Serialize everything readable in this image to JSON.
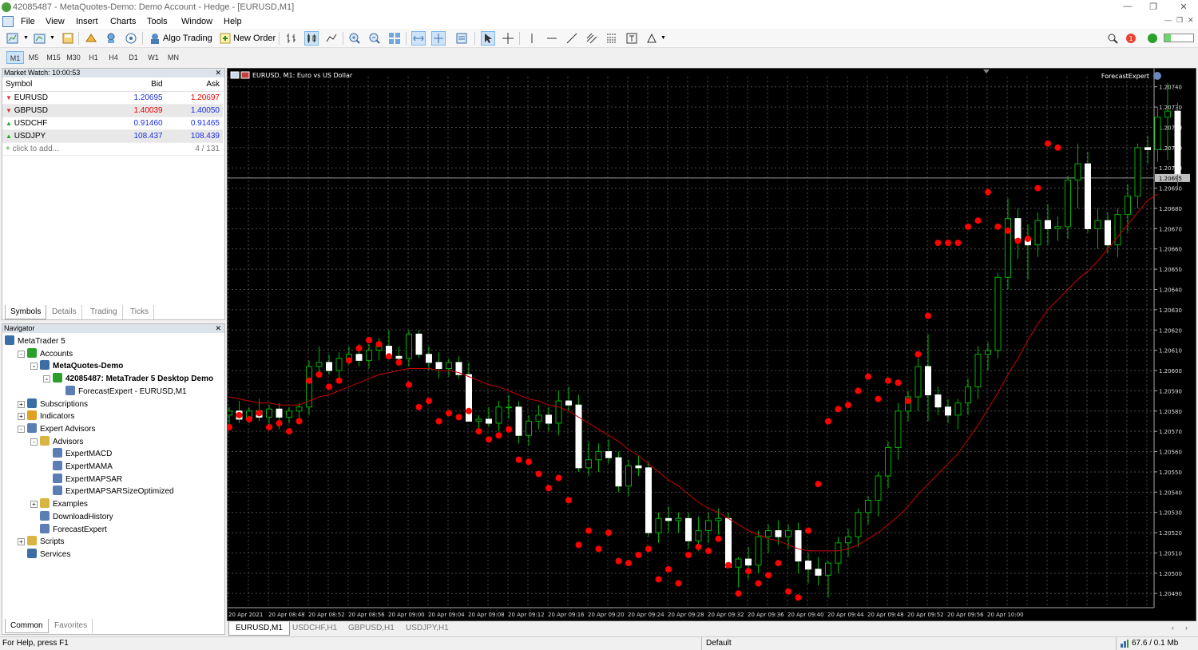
{
  "window": {
    "title": "42085487 - MetaQuotes-Demo: Demo Account - Hedge - [EURUSD,M1]"
  },
  "menu": [
    "File",
    "View",
    "Insert",
    "Charts",
    "Tools",
    "Window",
    "Help"
  ],
  "toolbar": {
    "algo_trading": "Algo Trading",
    "new_order": "New Order"
  },
  "timeframes": [
    "M1",
    "M5",
    "M15",
    "M30",
    "H1",
    "H4",
    "D1",
    "W1",
    "MN"
  ],
  "active_timeframe": "M1",
  "market_watch": {
    "title": "Market Watch: 10:00:53",
    "headers": [
      "Symbol",
      "Bid",
      "Ask"
    ],
    "rows": [
      {
        "symbol": "EURUSD",
        "bid": "1.20695",
        "ask": "1.20697",
        "dir": "down",
        "bid_color": "up",
        "ask_color": "dn"
      },
      {
        "symbol": "GBPUSD",
        "bid": "1.40039",
        "ask": "1.40050",
        "dir": "down",
        "bid_color": "dn",
        "ask_color": "up"
      },
      {
        "symbol": "USDCHF",
        "bid": "0.91460",
        "ask": "0.91465",
        "dir": "up",
        "bid_color": "up",
        "ask_color": "up"
      },
      {
        "symbol": "USDJPY",
        "bid": "108.437",
        "ask": "108.439",
        "dir": "up",
        "bid_color": "up",
        "ask_color": "up"
      }
    ],
    "add_text": "click to add...",
    "count": "4 / 131",
    "tabs": [
      "Symbols",
      "Details",
      "Trading",
      "Ticks"
    ]
  },
  "navigator": {
    "title": "Navigator",
    "items": [
      {
        "label": "MetaTrader 5",
        "level": 0,
        "icon": "mt5-icon",
        "expand": ""
      },
      {
        "label": "Accounts",
        "level": 1,
        "icon": "accounts-icon",
        "expand": "-"
      },
      {
        "label": "MetaQuotes-Demo",
        "level": 2,
        "icon": "server-icon",
        "expand": "-",
        "bold": true
      },
      {
        "label": "42085487: MetaTrader 5 Desktop Demo",
        "level": 3,
        "icon": "account-icon",
        "expand": "-",
        "bold": true
      },
      {
        "label": "ForecastExpert - EURUSD,M1",
        "level": 4,
        "icon": "expert-icon",
        "expand": ""
      },
      {
        "label": "Subscriptions",
        "level": 1,
        "icon": "subscriptions-icon",
        "expand": "+"
      },
      {
        "label": "Indicators",
        "level": 1,
        "icon": "indicators-icon",
        "expand": "+"
      },
      {
        "label": "Expert Advisors",
        "level": 1,
        "icon": "expert-advisors-icon",
        "expand": "-"
      },
      {
        "label": "Advisors",
        "level": 2,
        "icon": "folder-icon",
        "expand": "-"
      },
      {
        "label": "ExpertMACD",
        "level": 3,
        "icon": "expert-icon",
        "expand": ""
      },
      {
        "label": "ExpertMAMA",
        "level": 3,
        "icon": "expert-icon",
        "expand": ""
      },
      {
        "label": "ExpertMAPSAR",
        "level": 3,
        "icon": "expert-icon",
        "expand": ""
      },
      {
        "label": "ExpertMAPSARSizeOptimized",
        "level": 3,
        "icon": "expert-icon",
        "expand": ""
      },
      {
        "label": "Examples",
        "level": 2,
        "icon": "folder-icon",
        "expand": "+"
      },
      {
        "label": "DownloadHistory",
        "level": 2,
        "icon": "expert-icon",
        "expand": ""
      },
      {
        "label": "ForecastExpert",
        "level": 2,
        "icon": "expert-icon",
        "expand": ""
      },
      {
        "label": "Scripts",
        "level": 1,
        "icon": "scripts-icon",
        "expand": "+"
      },
      {
        "label": "Services",
        "level": 1,
        "icon": "services-icon",
        "expand": ""
      }
    ],
    "tabs": [
      "Common",
      "Favorites"
    ]
  },
  "chart": {
    "header": "EURUSD, M1:  Euro vs US Dollar",
    "expert_label": "ForecastExpert",
    "current_price": "1.20695",
    "tabs": [
      "EURUSD,M1",
      "USDCHF,H1",
      "GBPUSD,H1",
      "USDJPY,H1"
    ]
  },
  "chart_data": {
    "type": "candlestick",
    "symbol": "EURUSD",
    "timeframe": "M1",
    "ylim": [
      1.20483,
      1.20745
    ],
    "y_ticks": [
      "1.20740",
      "1.20730",
      "1.20720",
      "1.20710",
      "1.20700",
      "1.20690",
      "1.20680",
      "1.20670",
      "1.20660",
      "1.20650",
      "1.20640",
      "1.20630",
      "1.20620",
      "1.20610",
      "1.20600",
      "1.20590",
      "1.20580",
      "1.20570",
      "1.20560",
      "1.20550",
      "1.20540",
      "1.20530",
      "1.20520",
      "1.20510",
      "1.20500",
      "1.20490"
    ],
    "x_ticks": [
      "20 Apr 2021",
      "20 Apr 08:48",
      "20 Apr 08:52",
      "20 Apr 08:56",
      "20 Apr 09:00",
      "20 Apr 09:04",
      "20 Apr 09:08",
      "20 Apr 09:12",
      "20 Apr 09:16",
      "20 Apr 09:20",
      "20 Apr 09:24",
      "20 Apr 09:28",
      "20 Apr 09:32",
      "20 Apr 09:36",
      "20 Apr 09:40",
      "20 Apr 09:44",
      "20 Apr 09:48",
      "20 Apr 09:52",
      "20 Apr 09:56",
      "20 Apr 10:00"
    ],
    "ohlc": [
      [
        1.20578,
        1.20582,
        1.20572,
        1.2058
      ],
      [
        1.2058,
        1.20585,
        1.20574,
        1.20576
      ],
      [
        1.20576,
        1.20582,
        1.20574,
        1.2058
      ],
      [
        1.2058,
        1.20586,
        1.20575,
        1.20577
      ],
      [
        1.20577,
        1.20583,
        1.20573,
        1.20581
      ],
      [
        1.20581,
        1.20584,
        1.20571,
        1.20577
      ],
      [
        1.20577,
        1.20582,
        1.20574,
        1.2058
      ],
      [
        1.2058,
        1.20584,
        1.20576,
        1.20582
      ],
      [
        1.20582,
        1.20605,
        1.20578,
        1.20602
      ],
      [
        1.20602,
        1.20612,
        1.20598,
        1.20604
      ],
      [
        1.20604,
        1.20608,
        1.20598,
        1.206
      ],
      [
        1.206,
        1.20609,
        1.20596,
        1.20606
      ],
      [
        1.20606,
        1.20612,
        1.20603,
        1.20608
      ],
      [
        1.20608,
        1.20613,
        1.20602,
        1.20605
      ],
      [
        1.20605,
        1.20613,
        1.20601,
        1.2061
      ],
      [
        1.2061,
        1.20616,
        1.20605,
        1.20612
      ],
      [
        1.20612,
        1.2062,
        1.20608,
        1.20607
      ],
      [
        1.20607,
        1.20612,
        1.20603,
        1.20606
      ],
      [
        1.20606,
        1.2062,
        1.20602,
        1.20618
      ],
      [
        1.20618,
        1.2062,
        1.20606,
        1.20608
      ],
      [
        1.20608,
        1.20612,
        1.206,
        1.20604
      ],
      [
        1.20604,
        1.20609,
        1.20596,
        1.20601
      ],
      [
        1.20601,
        1.20606,
        1.20597,
        1.20604
      ],
      [
        1.20604,
        1.20607,
        1.20596,
        1.20598
      ],
      [
        1.20598,
        1.20604,
        1.20576,
        1.20575
      ],
      [
        1.20575,
        1.20578,
        1.2057,
        1.20576
      ],
      [
        1.20576,
        1.20582,
        1.20572,
        1.20574
      ],
      [
        1.20574,
        1.20585,
        1.2057,
        1.20582
      ],
      [
        1.20582,
        1.20588,
        1.20576,
        1.20582
      ],
      [
        1.20582,
        1.20585,
        1.20564,
        1.20568
      ],
      [
        1.20568,
        1.20578,
        1.20563,
        1.20575
      ],
      [
        1.20575,
        1.20583,
        1.20571,
        1.20578
      ],
      [
        1.20578,
        1.20582,
        1.2057,
        1.20574
      ],
      [
        1.20574,
        1.2059,
        1.20568,
        1.20585
      ],
      [
        1.20585,
        1.20592,
        1.2058,
        1.20583
      ],
      [
        1.20583,
        1.20588,
        1.2055,
        1.20552
      ],
      [
        1.20552,
        1.20565,
        1.20548,
        1.20556
      ],
      [
        1.20556,
        1.20564,
        1.2055,
        1.2056
      ],
      [
        1.2056,
        1.20566,
        1.20554,
        1.20557
      ],
      [
        1.20557,
        1.2056,
        1.2054,
        1.20543
      ],
      [
        1.20543,
        1.20556,
        1.20538,
        1.20553
      ],
      [
        1.20553,
        1.20558,
        1.20548,
        1.20552
      ],
      [
        1.20552,
        1.20555,
        1.20518,
        1.2052
      ],
      [
        1.2052,
        1.2053,
        1.20515,
        1.20527
      ],
      [
        1.20527,
        1.20533,
        1.2052,
        1.20526
      ],
      [
        1.20526,
        1.2053,
        1.2052,
        1.20527
      ],
      [
        1.20527,
        1.2053,
        1.20512,
        1.20516
      ],
      [
        1.20516,
        1.20528,
        1.20511,
        1.20521
      ],
      [
        1.20521,
        1.2053,
        1.20515,
        1.20526
      ],
      [
        1.20526,
        1.20532,
        1.20519,
        1.20527
      ],
      [
        1.20527,
        1.2053,
        1.20508,
        1.20503
      ],
      [
        1.20503,
        1.20508,
        1.20493,
        1.20507
      ],
      [
        1.20507,
        1.20513,
        1.20497,
        1.20504
      ],
      [
        1.20504,
        1.20521,
        1.205,
        1.20518
      ],
      [
        1.20518,
        1.20524,
        1.2051,
        1.20521
      ],
      [
        1.20521,
        1.20526,
        1.20514,
        1.20518
      ],
      [
        1.20518,
        1.20524,
        1.20512,
        1.20521
      ],
      [
        1.20521,
        1.20525,
        1.205,
        1.20506
      ],
      [
        1.20506,
        1.2051,
        1.20495,
        1.20502
      ],
      [
        1.20502,
        1.20508,
        1.20494,
        1.20499
      ],
      [
        1.20499,
        1.20506,
        1.20488,
        1.20505
      ],
      [
        1.20505,
        1.20518,
        1.205,
        1.20515
      ],
      [
        1.20515,
        1.20522,
        1.20508,
        1.20518
      ],
      [
        1.20518,
        1.20532,
        1.20513,
        1.2053
      ],
      [
        1.2053,
        1.20538,
        1.20524,
        1.20536
      ],
      [
        1.20536,
        1.2055,
        1.20528,
        1.20548
      ],
      [
        1.20548,
        1.20565,
        1.20542,
        1.20562
      ],
      [
        1.20562,
        1.20584,
        1.20556,
        1.2058
      ],
      [
        1.2058,
        1.2059,
        1.20575,
        1.20587
      ],
      [
        1.20587,
        1.20606,
        1.2058,
        1.20602
      ],
      [
        1.20602,
        1.20618,
        1.20575,
        1.20588
      ],
      [
        1.20588,
        1.20592,
        1.20578,
        1.20582
      ],
      [
        1.20582,
        1.20586,
        1.20574,
        1.20578
      ],
      [
        1.20578,
        1.20586,
        1.20571,
        1.20584
      ],
      [
        1.20584,
        1.20596,
        1.20578,
        1.20592
      ],
      [
        1.20592,
        1.20612,
        1.20586,
        1.20608
      ],
      [
        1.20608,
        1.20614,
        1.206,
        1.2061
      ],
      [
        1.2061,
        1.20648,
        1.20606,
        1.20646
      ],
      [
        1.20646,
        1.20685,
        1.2064,
        1.20675
      ],
      [
        1.20675,
        1.2068,
        1.20655,
        1.20665
      ],
      [
        1.20665,
        1.20672,
        1.20645,
        1.20662
      ],
      [
        1.20662,
        1.20678,
        1.20656,
        1.20674
      ],
      [
        1.20674,
        1.20682,
        1.20662,
        1.2067
      ],
      [
        1.2067,
        1.20676,
        1.20664,
        1.20671
      ],
      [
        1.20671,
        1.20696,
        1.20665,
        1.20694
      ],
      [
        1.20694,
        1.20712,
        1.2068,
        1.20702
      ],
      [
        1.20702,
        1.20708,
        1.20668,
        1.2067
      ],
      [
        1.2067,
        1.2068,
        1.2066,
        1.20674
      ],
      [
        1.20674,
        1.20678,
        1.20658,
        1.20662
      ],
      [
        1.20662,
        1.2068,
        1.20656,
        1.20677
      ],
      [
        1.20677,
        1.20692,
        1.20668,
        1.20686
      ],
      [
        1.20686,
        1.20712,
        1.2068,
        1.2071
      ],
      [
        1.2071,
        1.20716,
        1.20702,
        1.20709
      ],
      [
        1.20709,
        1.2073,
        1.20703,
        1.20725
      ],
      [
        1.20725,
        1.20742,
        1.20704,
        1.20728
      ],
      [
        1.20728,
        1.20732,
        1.2069,
        1.20697
      ]
    ],
    "markers": [
      1.20572,
      1.20578,
      1.20576,
      1.20579,
      1.20572,
      1.20574,
      1.2057,
      1.20575,
      1.20595,
      1.20598,
      1.20592,
      1.20595,
      1.20605,
      1.20611,
      1.20615,
      1.20613,
      1.20607,
      1.20604,
      1.20593,
      1.20582,
      1.20585,
      1.20575,
      1.20579,
      1.20577,
      1.2058,
      1.2057,
      1.20566,
      1.20568,
      1.20571,
      1.20556,
      1.20555,
      1.20549,
      1.20542,
      1.20547,
      1.20536,
      1.20514,
      1.20521,
      1.20512,
      1.2052,
      1.20506,
      1.20505,
      1.20509,
      1.20512,
      1.20497,
      1.20502,
      1.20495,
      1.20509,
      1.20513,
      1.20511,
      1.20517,
      1.20504,
      1.2049,
      1.20501,
      1.20495,
      1.20499,
      1.20505,
      1.20491,
      1.20488,
      1.20521,
      1.20544,
      1.20575,
      1.20581,
      1.20583,
      1.2059,
      1.20597,
      1.20586,
      1.20595,
      1.20594,
      1.20585,
      1.20608,
      1.20627,
      1.20663,
      1.20663,
      1.20663,
      1.20671,
      1.20674,
      1.20688,
      1.20671,
      1.20669,
      1.20664,
      1.20665,
      1.2069,
      1.20712,
      1.2071
    ],
    "ma": {
      "color": "#cc0000",
      "values": [
        1.20587,
        1.20586,
        1.20585,
        1.20584,
        1.20584,
        1.20583,
        1.20583,
        1.20583,
        1.20585,
        1.20587,
        1.20588,
        1.2059,
        1.20592,
        1.20594,
        1.20596,
        1.20598,
        1.20599,
        1.206,
        1.20601,
        1.20601,
        1.20601,
        1.206,
        1.206,
        1.20599,
        1.20597,
        1.20595,
        1.20593,
        1.20592,
        1.2059,
        1.20588,
        1.20586,
        1.20585,
        1.20583,
        1.20582,
        1.2058,
        1.20577,
        1.20574,
        1.20571,
        1.20568,
        1.20565,
        1.20561,
        1.20558,
        1.20554,
        1.2055,
        1.20546,
        1.20543,
        1.20539,
        1.20535,
        1.20532,
        1.2053,
        1.20527,
        1.20524,
        1.20521,
        1.20519,
        1.20517,
        1.20516,
        1.20514,
        1.20512,
        1.20511,
        1.20511,
        1.20511,
        1.20511,
        1.20512,
        1.20514,
        1.20517,
        1.2052,
        1.20524,
        1.20528,
        1.20533,
        1.20539,
        1.20544,
        1.20549,
        1.20554,
        1.20559,
        1.20566,
        1.20573,
        1.20581,
        1.20589,
        1.20598,
        1.20606,
        1.20615,
        1.20623,
        1.2063,
        1.20635,
        1.2064,
        1.20645,
        1.20649,
        1.20654,
        1.2066,
        1.20666,
        1.20672,
        1.20678,
        1.20684,
        1.20687
      ]
    },
    "bull_color": "#00b000",
    "bear_color": "#ffffff",
    "marker_color": "#ff0000",
    "grid": true
  },
  "status": {
    "help": "For Help, press F1",
    "profile": "Default",
    "traffic": "67.6 / 0.1 Mb"
  }
}
